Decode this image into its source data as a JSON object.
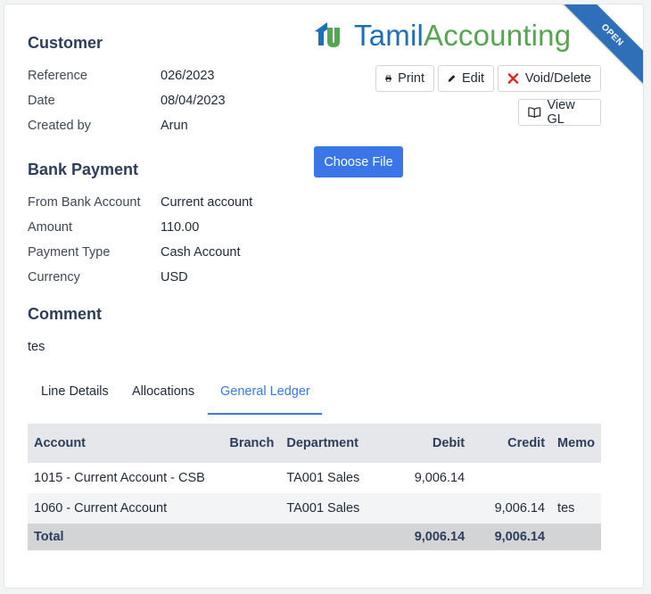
{
  "brand": {
    "logo_part1": "Tamil",
    "logo_part2": "Accounting",
    "status_ribbon": "OPEN"
  },
  "customer": {
    "title": "Customer",
    "fields": [
      {
        "label": "Reference",
        "value": "026/2023"
      },
      {
        "label": "Date",
        "value": "08/04/2023"
      },
      {
        "label": "Created by",
        "value": "Arun"
      }
    ]
  },
  "actions": {
    "print": "Print",
    "edit": "Edit",
    "void_delete": "Void/Delete",
    "view_gl": "View GL",
    "choose_file": "Choose File"
  },
  "bank_payment": {
    "title": "Bank Payment",
    "fields": [
      {
        "label": "From Bank Account",
        "value": "Current account"
      },
      {
        "label": "Amount",
        "value": "110.00"
      },
      {
        "label": "Payment Type",
        "value": "Cash Account"
      },
      {
        "label": "Currency",
        "value": "USD"
      }
    ]
  },
  "comment": {
    "title": "Comment",
    "text": "tes"
  },
  "tabs": [
    {
      "label": "Line Details",
      "active": false
    },
    {
      "label": "Allocations",
      "active": false
    },
    {
      "label": "General Ledger",
      "active": true
    }
  ],
  "ledger": {
    "headers": {
      "account": "Account",
      "branch": "Branch",
      "department": "Department",
      "debit": "Debit",
      "credit": "Credit",
      "memo": "Memo"
    },
    "rows": [
      {
        "account": "1015 - Current Account - CSB",
        "branch": "",
        "department": "TA001 Sales",
        "debit": "9,006.14",
        "credit": "",
        "memo": ""
      },
      {
        "account": "1060 - Current Account",
        "branch": "",
        "department": "TA001 Sales",
        "debit": "",
        "credit": "9,006.14",
        "memo": "tes"
      }
    ],
    "total": {
      "label": "Total",
      "debit": "9,006.14",
      "credit": "9,006.14"
    }
  },
  "colors": {
    "accent": "#3b76e8",
    "ribbon": "#2f6fb8",
    "logo_blue": "#1e6fb8",
    "logo_green": "#55a650",
    "danger": "#e02424"
  }
}
